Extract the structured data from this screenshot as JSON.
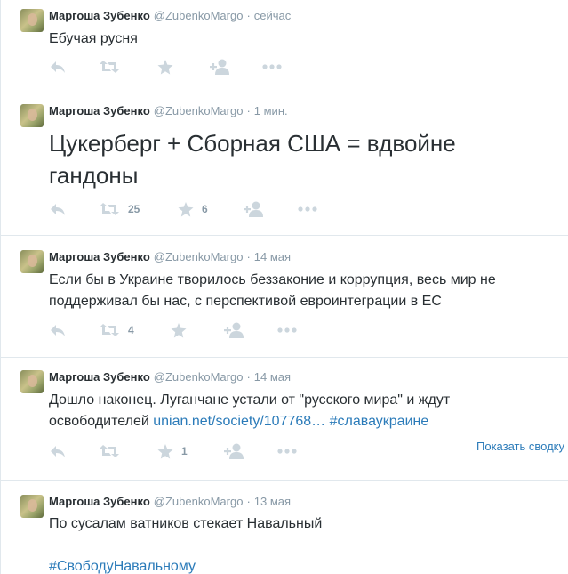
{
  "colors": {
    "accent": "#2b7bb9",
    "muted": "#8899a6",
    "text": "#292f33",
    "icon": "#ccd6dd"
  },
  "tweets": [
    {
      "fullname": "Маргоша Зубенко",
      "username": "@ZubenkoMargo",
      "time": "сейчас",
      "text": "Ебучая русня",
      "retweets": "",
      "favorites": ""
    },
    {
      "fullname": "Маргоша Зубенко",
      "username": "@ZubenkoMargo",
      "time": "1 мин.",
      "text_line1": "Цукерберг + Сборная США = вдвойне",
      "text_line2": "гандоны",
      "retweets": "25",
      "favorites": "6"
    },
    {
      "fullname": "Маргоша Зубенко",
      "username": "@ZubenkoMargo",
      "time": "14 мая",
      "text_line1": "Если бы в Украине творилось беззаконие и коррупция, весь мир не",
      "text_line2": "поддерживал бы нас, с перспективой евроинтеграции в ЕС",
      "retweets": "4",
      "favorites": ""
    },
    {
      "fullname": "Маргоша Зубенко",
      "username": "@ZubenkoMargo",
      "time": "14 мая",
      "text_line1": "Дошло наконец. Луганчане устали от \"русского мира\" и ждут",
      "text_line2_prefix": "освободителей ",
      "link": "unian.net/society/107768…",
      "hashtag": "#славаукраине",
      "retweets": "",
      "favorites": "1",
      "summary_label": "Показать сводку"
    },
    {
      "fullname": "Маргоша Зубенко",
      "username": "@ZubenkoMargo",
      "time": "13 мая",
      "text": "По сусалам ватников стекает Навальный",
      "hashtag": "#СвободуНавальному"
    }
  ],
  "icons": {
    "reply": "reply-icon",
    "retweet": "retweet-icon",
    "favorite": "star-icon",
    "follow": "follow-icon",
    "more": "more-icon"
  }
}
